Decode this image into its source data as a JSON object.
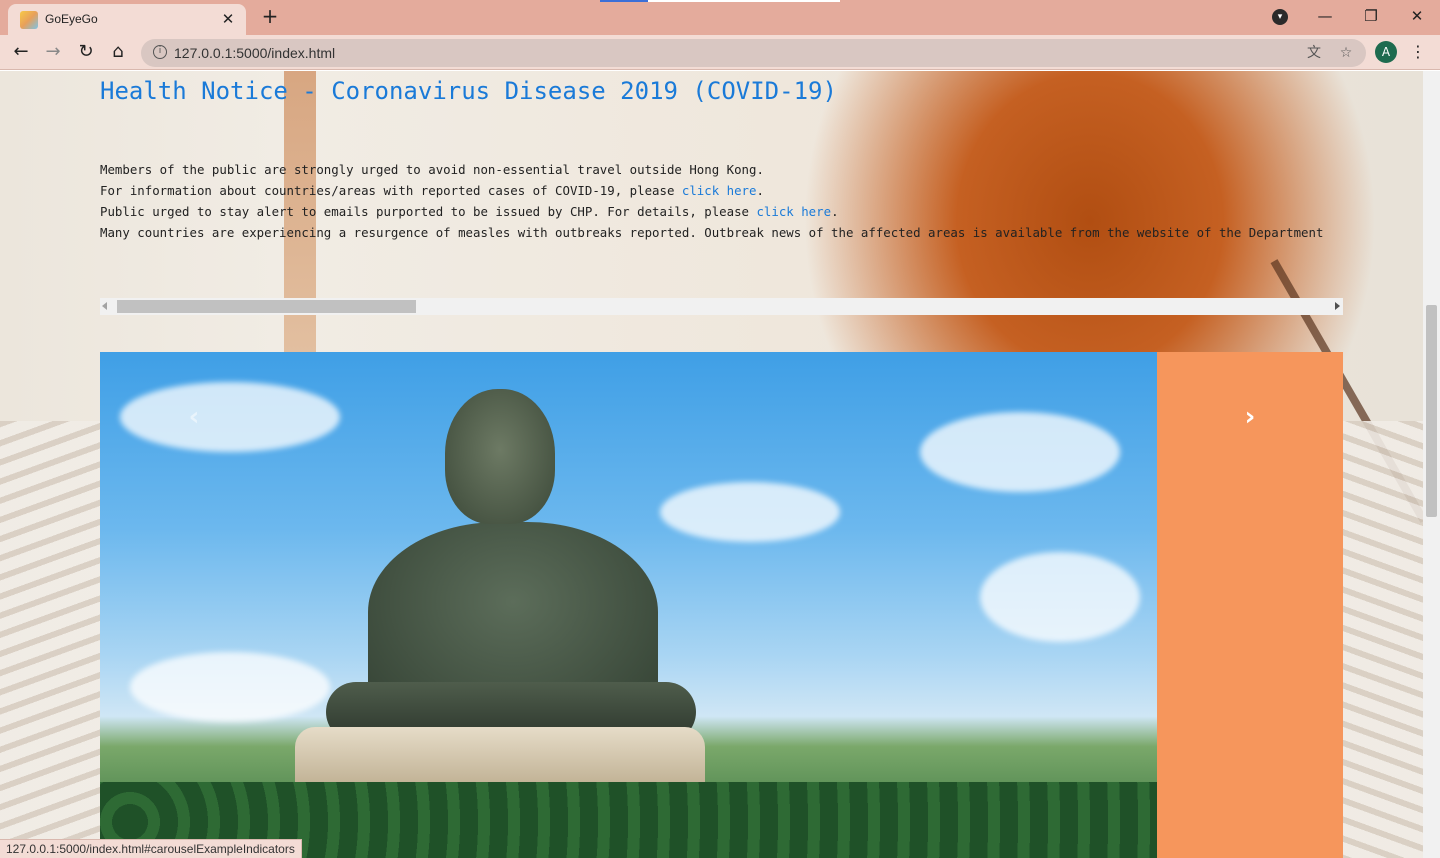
{
  "browser": {
    "tab_title": "GoEyeGo",
    "tab_close": "✕",
    "new_tab": "+",
    "url": "127.0.0.1:5000/index.html",
    "window_minimize": "—",
    "window_restore": "❐",
    "window_close": "✕",
    "profile_initial": "A",
    "status_url": "127.0.0.1:5000/index.html#carouselExampleIndicators"
  },
  "notice": {
    "title": "Health Notice - Coronavirus Disease 2019 (COVID-19)",
    "line1": "Members of the public are strongly urged to avoid non-essential travel outside Hong Kong.",
    "line2_prefix": "For information about countries/areas with reported cases of COVID-19, please ",
    "line2_link": "click here",
    "line2_suffix": ".",
    "line3_prefix": "Public urged to stay alert to emails purported to be issued by CHP. For details, please ",
    "line3_link": "click here",
    "line3_suffix": ".",
    "line4": "Many countries are experiencing a resurgence of measles with outbreaks reported. Outbreak news of the affected areas is available from the website of the Department"
  },
  "carousel": {
    "prev_label": "‹",
    "next_label": "›"
  },
  "colors": {
    "accent_link": "#1a7ad8",
    "tab_bar": "#e4ab9c",
    "carousel_side": "#f6965c"
  }
}
